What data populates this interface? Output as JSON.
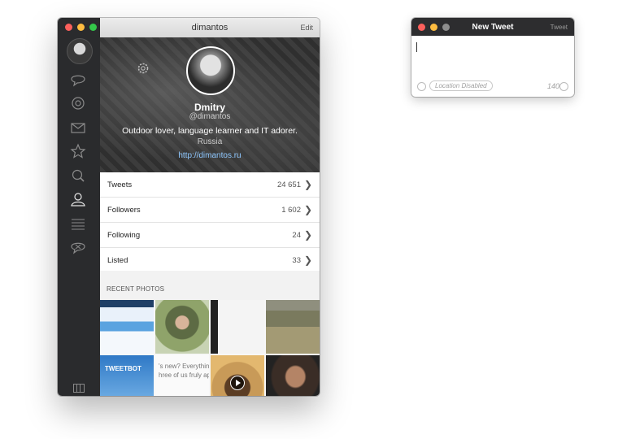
{
  "main_window": {
    "title": "dimantos",
    "edit_label": "Edit",
    "sidebar": {
      "items": [
        {
          "icon": "speech-bubble-icon"
        },
        {
          "icon": "at-sign-icon"
        },
        {
          "icon": "envelope-icon"
        },
        {
          "icon": "star-icon"
        },
        {
          "icon": "search-icon"
        },
        {
          "icon": "user-icon"
        },
        {
          "icon": "lists-icon"
        },
        {
          "icon": "muted-bubble-icon"
        }
      ]
    },
    "profile": {
      "name": "Dmitry",
      "handle": "@dimantos",
      "bio": "Outdoor lover, language learner and IT adorer.",
      "location": "Russia",
      "url": "http://dimantos.ru"
    },
    "stats": [
      {
        "label": "Tweets",
        "value": "24 651"
      },
      {
        "label": "Followers",
        "value": "1 602"
      },
      {
        "label": "Following",
        "value": "24"
      },
      {
        "label": "Listed",
        "value": "33"
      }
    ],
    "recent_photos_label": "RECENT PHOTOS",
    "photo_texts": {
      "tweetbot_label": "TWEETBOT",
      "text_line_1": "'s new? Everything i",
      "text_line_2": "hree of us fruly app"
    }
  },
  "new_tweet_window": {
    "title": "New Tweet",
    "send_label": "Tweet",
    "location_label": "Location Disabled",
    "char_count": "140"
  },
  "colors": {
    "sidebar_bg": "#2a2b2d",
    "link": "#8fc8ff",
    "close": "#fc605c",
    "minimize": "#fdbc40",
    "zoom": "#34c84a"
  }
}
